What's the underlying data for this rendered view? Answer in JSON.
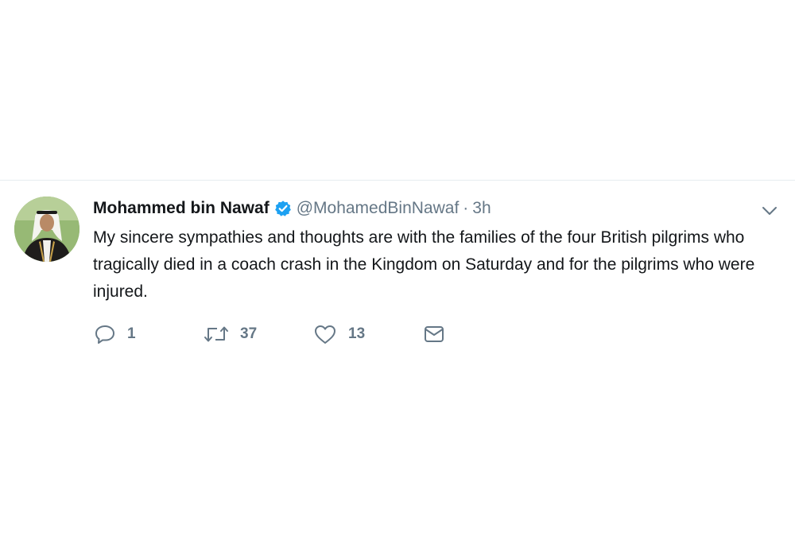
{
  "tweet": {
    "display_name": "Mohammed bin Nawaf",
    "verified_icon": "verified-badge-icon",
    "handle": "@MohamedBinNawaf",
    "separator": "·",
    "time": "3h",
    "text": "My sincere sympathies and thoughts are with the families of the four British pilgrims who tragically died in a coach crash in the Kingdom on Saturday and for the pilgrims who were injured.",
    "actions": {
      "reply_count": "1",
      "retweet_count": "37",
      "like_count": "13"
    }
  },
  "colors": {
    "verified": "#1da1f2",
    "secondary_text": "#657786",
    "primary_text": "#14171a",
    "divider": "#e6ecf0"
  }
}
